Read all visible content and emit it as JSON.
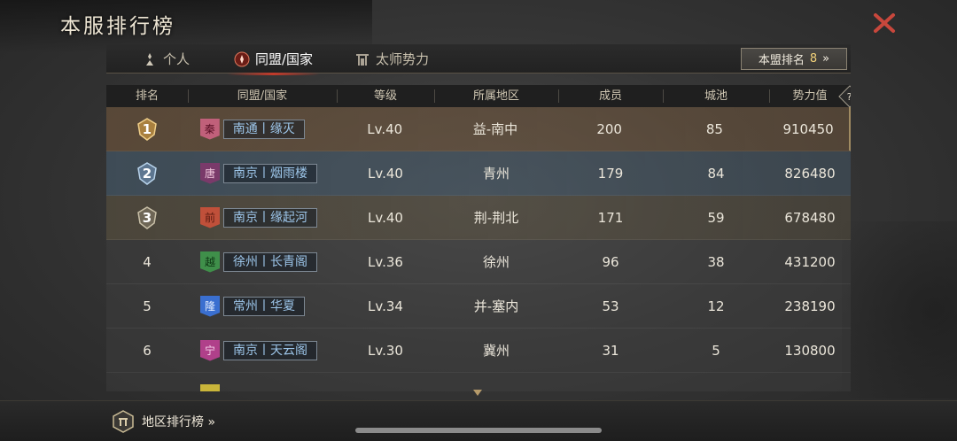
{
  "window": {
    "title": "本服排行榜"
  },
  "tabs": [
    {
      "label": "个人",
      "icon": "person-icon",
      "active": false
    },
    {
      "label": "同盟/国家",
      "icon": "alliance-emblem-icon",
      "active": true
    },
    {
      "label": "太师势力",
      "icon": "gate-icon",
      "active": false
    }
  ],
  "my_rank": {
    "label": "本盟排名",
    "value": "8",
    "arrow": "»"
  },
  "table": {
    "columns": [
      "排名",
      "同盟/国家",
      "等级",
      "所属地区",
      "成员",
      "城池",
      "势力值"
    ],
    "rows": [
      {
        "rank": "1",
        "flag_char": "秦",
        "flag_color": "#c0607a",
        "name": "南通丨缘灭",
        "level": "Lv.40",
        "region": "益-南中",
        "members": "200",
        "cities": "85",
        "power": "910450"
      },
      {
        "rank": "2",
        "flag_char": "唐",
        "flag_color": "#7a3a6a",
        "name": "南京丨烟雨楼",
        "level": "Lv.40",
        "region": "青州",
        "members": "179",
        "cities": "84",
        "power": "826480"
      },
      {
        "rank": "3",
        "flag_char": "前",
        "flag_color": "#c0503a",
        "name": "南京丨缘起河",
        "level": "Lv.40",
        "region": "荆-荆北",
        "members": "171",
        "cities": "59",
        "power": "678480"
      },
      {
        "rank": "4",
        "flag_char": "越",
        "flag_color": "#3f8f4a",
        "name": "徐州丨长青阁",
        "level": "Lv.36",
        "region": "徐州",
        "members": "96",
        "cities": "38",
        "power": "431200"
      },
      {
        "rank": "5",
        "flag_char": "隆",
        "flag_color": "#3a6fd0",
        "name": "常州丨华夏",
        "level": "Lv.34",
        "region": "并-塞内",
        "members": "53",
        "cities": "12",
        "power": "238190"
      },
      {
        "rank": "6",
        "flag_char": "宁",
        "flag_color": "#b0408a",
        "name": "南京丨天云阁",
        "level": "Lv.30",
        "region": "冀州",
        "members": "31",
        "cities": "5",
        "power": "130800"
      }
    ]
  },
  "footer": {
    "region_ranking": "地区排行榜 »"
  },
  "colors": {
    "accent_red": "#c23a2a",
    "gold": "#f2d27a",
    "tag_text": "#9dc6ea"
  }
}
